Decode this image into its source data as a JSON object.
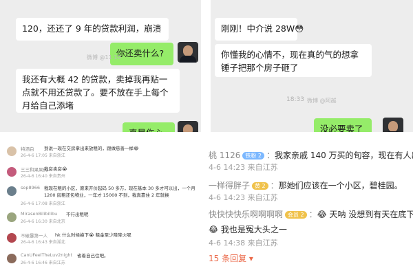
{
  "chat_left": {
    "messages": [
      {
        "side": "in",
        "text": "120，还还了 9 年的贷款利润，崩溃"
      },
      {
        "side": "out",
        "text": "你还卖什么?"
      },
      {
        "side": "in",
        "text": "我还有大概 42 的贷款，卖掉我再贴一点就不用还贷款了。要不放在手上每个月给自己添堵"
      },
      {
        "side": "out",
        "text": "真是伤心"
      }
    ],
    "watermark": "微博 @11 10"
  },
  "chat_right": {
    "messages": [
      {
        "side": "in",
        "text": "刚刚！中介说 28W😳"
      },
      {
        "side": "in",
        "text": "你懂我的心情不，现在真的气的想拿锤子把那个房子砸了"
      },
      {
        "side": "out",
        "text": "没必要卖了"
      }
    ],
    "time": "18:33",
    "watermark": "微博 @阿越"
  },
  "comments_left": [
    {
      "name": "特洒白",
      "text": "到说一现在交房拿出来放租的，跟做慈善一样😂",
      "meta": "26-4-6 17:05 来自浙江",
      "avatar": "#d9c2a8"
    },
    {
      "name": "三三和果果们",
      "text": "我房卖房😭",
      "meta": "26-4-6 16:40 来自贵州",
      "avatar": "#c45b7c"
    },
    {
      "name": "sep8966",
      "text": "我现在租的小区，原来开价起码 50 多万，现在基本 30 多才可以出，一个月 1200 房租还包物业，一年才 15000 不到，我真靠住 2 年就换",
      "meta": "26-4-6 17:08",
      "meta2": "来自浙江",
      "avatar": "#6b7f8c"
    },
    {
      "name": "MirasenBilibilibu",
      "text": "不行出租呢",
      "meta": "26-4-6 16:30 来自北京",
      "avatar": "#9aa57e"
    },
    {
      "name": "不破暴第一人",
      "text": "hk 什么时候换下😭 租金至少降降火呢",
      "meta": "26-4-6 16:43 来自湖北",
      "avatar": "#b3474f"
    },
    {
      "name": "CanUFeelTheLuv2night",
      "text": "省着自己住吧。",
      "meta": "26-4-6 16:46 来自江苏",
      "avatar": "#8b6b5c"
    }
  ],
  "comments_right": {
    "c1": {
      "name": "桃 1126",
      "badge": "铁粉 2",
      "text": "我家亲戚 140 万买的旬容，现在有人出 38 万",
      "meta": "4-6 14:23 来自江苏"
    },
    "c2": {
      "name": "一样得胖子",
      "badge": "黄 2",
      "text": "那她们应该在一个小区，碧桂园。",
      "meta": "4-6 14:23 来自江苏"
    },
    "c3": {
      "name": "快快快快乐啊啊啊啊",
      "badge": "会员 2",
      "text": "😂 天呐 没想到有天在底下以这",
      "text2": "😂 我也是冤大头之一",
      "meta": "4-6 14:38 来自江苏"
    },
    "more": "15 条回复 ▾"
  }
}
